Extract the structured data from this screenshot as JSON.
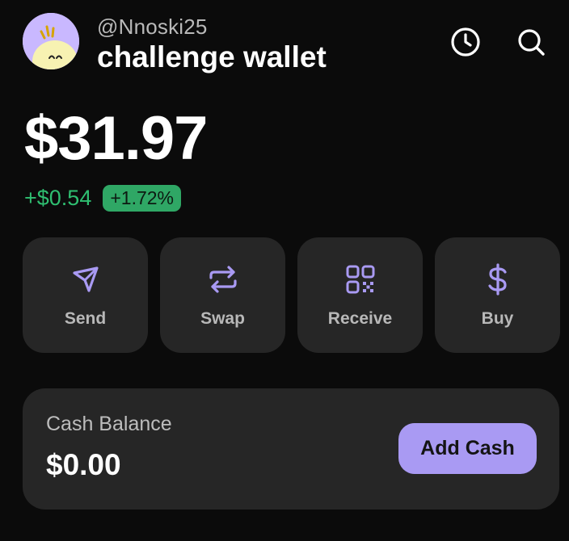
{
  "header": {
    "handle": "@Nnoski25",
    "wallet_name": "challenge wallet",
    "avatar_icon": "ghost-avatar-icon",
    "history_icon": "clock-icon",
    "search_icon": "search-icon"
  },
  "balance": {
    "total": "$31.97",
    "change_amount": "+$0.54",
    "change_percent": "+1.72%"
  },
  "actions": [
    {
      "label": "Send",
      "icon": "send-icon"
    },
    {
      "label": "Swap",
      "icon": "swap-icon"
    },
    {
      "label": "Receive",
      "icon": "qr-code-icon"
    },
    {
      "label": "Buy",
      "icon": "dollar-icon"
    }
  ],
  "cash": {
    "title": "Cash Balance",
    "value": "$0.00",
    "button_label": "Add Cash"
  },
  "colors": {
    "background": "#0b0b0b",
    "card": "#262626",
    "accent": "#a99af3",
    "positive": "#2fbf71",
    "badge": "#2fa765"
  }
}
